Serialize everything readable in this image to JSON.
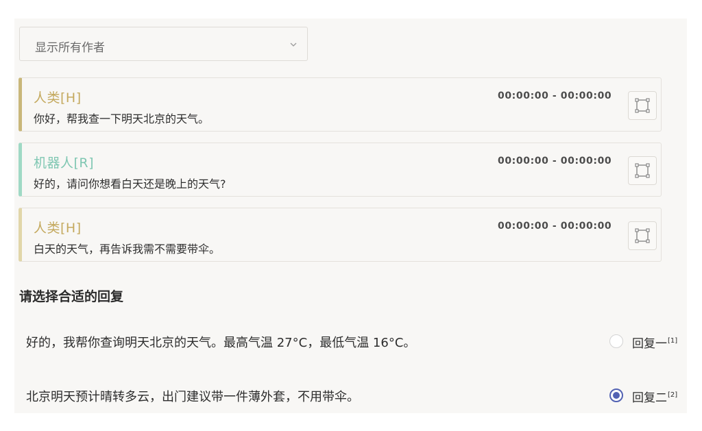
{
  "author_filter": {
    "selected": "显示所有作者"
  },
  "messages": [
    {
      "speaker": "人类[H]",
      "text": "你好，帮我查一下明天北京的天气。",
      "time": "00:00:00 - 00:00:00"
    },
    {
      "speaker": "机器人[R]",
      "text": "好的，请问你想看白天还是晚上的天气?",
      "time": "00:00:00 - 00:00:00"
    },
    {
      "speaker": "人类[H]",
      "text": "白天的天气，再告诉我需不需要带伞。",
      "time": "00:00:00 - 00:00:00"
    }
  ],
  "reply_section": {
    "title": "请选择合适的回复",
    "options": [
      {
        "text": "好的，我帮你查询明天北京的天气。最高气温 27°C，最低气温 16°C。",
        "label": "回复一",
        "ref": "[1]",
        "selected": false
      },
      {
        "text": "北京明天预计晴转多云，出门建议带一件薄外套，不用带伞。",
        "label": "回复二",
        "ref": "[2]",
        "selected": true
      }
    ]
  },
  "colors": {
    "human_accent": "#c4a95e",
    "bot_accent": "#7fc7b2",
    "radio_selected": "#5262b3"
  },
  "icons": {
    "select_arrow": "chevron-down-icon",
    "expand": "bounding-box-icon"
  }
}
